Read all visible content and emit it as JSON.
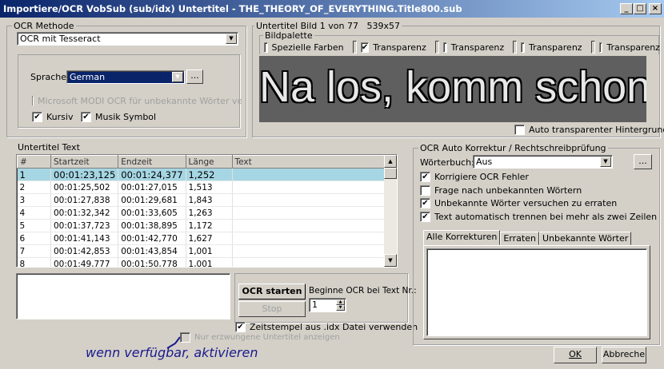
{
  "window": {
    "title": "Importiere/OCR VobSub (sub/idx) Untertitel - THE_THEORY_OF_EVERYTHING.Title800.sub",
    "minimize": "_",
    "maximize": "□",
    "close": "×"
  },
  "ocr_method": {
    "label": "OCR Methode",
    "value": "OCR mit Tesseract",
    "language_label": "Sprache",
    "language": "German",
    "more": "...",
    "modi": "Microsoft MODI OCR für unbekannte Wörter versuchen",
    "italic": "Kursiv",
    "music": "Musik Symbol"
  },
  "image": {
    "label": "Untertitel Bild 1 von 77   539x57",
    "palette_label": "Bildpalette",
    "special_colors": "Spezielle Farben",
    "transparency": [
      "Transparenz",
      "Transparenz",
      "Transparenz",
      "Transparenz"
    ],
    "transparency_checked": [
      true,
      false,
      false,
      false
    ],
    "subtitle_text": "Na los, komm schon!",
    "auto_transparent": "Auto transparenter Hintergrund"
  },
  "subtitles": {
    "label": "Untertitel Text",
    "columns": [
      "#",
      "Startzeit",
      "Endzeit",
      "Länge",
      "Text"
    ],
    "rows": [
      [
        "1",
        "00:01:23,125",
        "00:01:24,377",
        "1,252",
        ""
      ],
      [
        "2",
        "00:01:25,502",
        "00:01:27,015",
        "1,513",
        ""
      ],
      [
        "3",
        "00:01:27,838",
        "00:01:29,681",
        "1,843",
        ""
      ],
      [
        "4",
        "00:01:32,342",
        "00:01:33,605",
        "1,263",
        ""
      ],
      [
        "5",
        "00:01:37,723",
        "00:01:38,895",
        "1,172",
        ""
      ],
      [
        "6",
        "00:01:41,143",
        "00:01:42,770",
        "1,627",
        ""
      ],
      [
        "7",
        "00:01:42,853",
        "00:01:43,854",
        "1,001",
        ""
      ],
      [
        "8",
        "00:01:49,777",
        "00:01:50,778",
        "1,001",
        ""
      ]
    ]
  },
  "controls": {
    "start": "OCR starten",
    "stop": "Stop",
    "begin_label": "Beginne OCR bei Text Nr.:",
    "begin_value": "1",
    "timestamps": "Zeitstempel aus .idx Datei verwenden",
    "forced_only": "Nur erzwungene Untertitel anzeigen",
    "annotation": "wenn verfügbar, aktivieren"
  },
  "autocorrect": {
    "label": "OCR Auto Korrektur / Rechtschreibprüfung",
    "dict_label": "Wörterbuch:",
    "dict_value": "Aus",
    "more": "...",
    "options": [
      {
        "label": "Korrigiere OCR Fehler",
        "checked": true
      },
      {
        "label": "Frage nach unbekannten Wörtern",
        "checked": false
      },
      {
        "label": "Unbekannte Wörter versuchen zu erraten",
        "checked": true
      },
      {
        "label": "Text automatisch trennen bei mehr als zwei Zeilen",
        "checked": true
      }
    ],
    "tabs": [
      "Alle Korrekturen",
      "Erraten",
      "Unbekannte Wörter"
    ]
  },
  "footer": {
    "ok": "OK",
    "cancel": "Abbreche"
  }
}
